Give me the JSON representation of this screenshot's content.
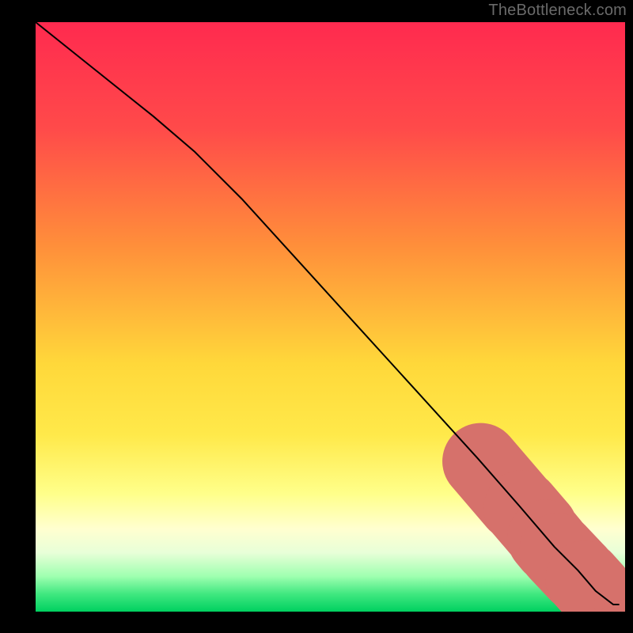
{
  "attribution": "TheBottleneck.com",
  "chart_data": {
    "type": "line",
    "title": "",
    "xlabel": "",
    "ylabel": "",
    "xlim": [
      0,
      100
    ],
    "ylim": [
      0,
      100
    ],
    "gradient_stops": [
      {
        "offset": 0,
        "color": "#ff2a4f"
      },
      {
        "offset": 18,
        "color": "#ff4a4a"
      },
      {
        "offset": 38,
        "color": "#ff8f3a"
      },
      {
        "offset": 58,
        "color": "#ffd83a"
      },
      {
        "offset": 70,
        "color": "#ffe94a"
      },
      {
        "offset": 80,
        "color": "#ffff8a"
      },
      {
        "offset": 86,
        "color": "#ffffd0"
      },
      {
        "offset": 90,
        "color": "#e8ffd8"
      },
      {
        "offset": 94,
        "color": "#9fffb0"
      },
      {
        "offset": 97,
        "color": "#40e880"
      },
      {
        "offset": 100,
        "color": "#00d060"
      }
    ],
    "series": [
      {
        "name": "bottleneck-curve",
        "type": "line",
        "color": "#000000",
        "x": [
          0,
          10,
          20,
          27,
          35,
          45,
          55,
          65,
          75,
          82,
          88,
          92,
          95,
          98,
          100
        ],
        "y": [
          100,
          92,
          84,
          78,
          70,
          59,
          48,
          37,
          26,
          18,
          11,
          7,
          3.5,
          1.2,
          1.2
        ]
      },
      {
        "name": "marker-segments",
        "type": "scatter",
        "color": "#d6716b",
        "segments": [
          {
            "x_start": 75.5,
            "y_start": 25.5,
            "x_end": 81.5,
            "y_end": 18.5
          },
          {
            "x_start": 82.5,
            "y_start": 17.5,
            "x_end": 85.5,
            "y_end": 14.0
          },
          {
            "x_start": 86.5,
            "y_start": 12.5,
            "x_end": 87.5,
            "y_end": 11.3
          },
          {
            "x_start": 88.5,
            "y_start": 10.2,
            "x_end": 92.0,
            "y_end": 6.5
          },
          {
            "x_start": 93.0,
            "y_start": 5.5,
            "x_end": 94.8,
            "y_end": 3.5
          }
        ],
        "end_points": [
          {
            "x": 95.5,
            "y": 1.2
          },
          {
            "x": 100,
            "y": 1.2
          }
        ]
      }
    ]
  }
}
